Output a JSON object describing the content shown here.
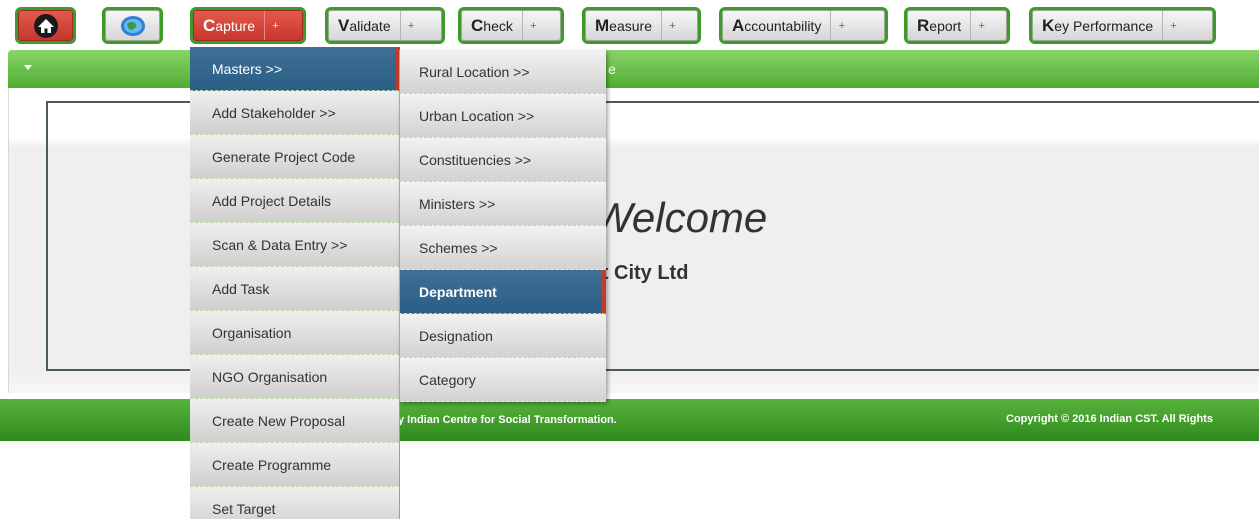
{
  "nav": {
    "home_icon": "home-icon",
    "globe_icon": "globe-icon",
    "items": [
      {
        "initial": "C",
        "rest": "apture",
        "plus": "+"
      },
      {
        "initial": "V",
        "rest": "alidate",
        "plus": "+"
      },
      {
        "initial": "C",
        "rest": "heck",
        "plus": "+"
      },
      {
        "initial": "M",
        "rest": "easure",
        "plus": "+"
      },
      {
        "initial": "A",
        "rest": "ccountability",
        "plus": "+"
      },
      {
        "initial": "R",
        "rest": "eport",
        "plus": "+"
      },
      {
        "initial": "K",
        "rest": "ey Performance",
        "plus": "+"
      }
    ]
  },
  "greenbar": {
    "text": "e"
  },
  "welcome": {
    "title": "Welcome",
    "company": "rt City Ltd"
  },
  "footer": {
    "left": "y Indian Centre for Social Transformation.",
    "right": "Copyright © 2016 Indian CST. All Rights"
  },
  "capture_menu": {
    "items": [
      "Masters >>",
      "Add Stakeholder >>",
      "Generate Project Code",
      "Add Project Details",
      "Scan & Data Entry >>",
      "Add Task",
      "Organisation",
      "NGO Organisation",
      "Create New Proposal",
      "Create Programme",
      "Set Target"
    ]
  },
  "masters_menu": {
    "items": [
      "Rural Location >>",
      "Urban Location >>",
      "Constituencies >>",
      "Ministers >>",
      "Schemes >>",
      "Department",
      "Designation",
      "Category"
    ]
  },
  "colors": {
    "nav_green": "#3f9a2c",
    "active_red": "#c8362c",
    "menu_selected": "#2b5f86",
    "footer_green": "#2f8a1d"
  }
}
